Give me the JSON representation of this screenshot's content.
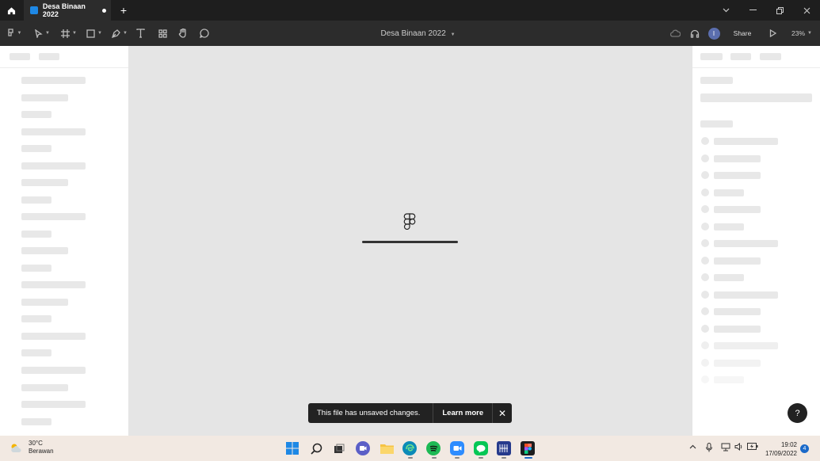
{
  "browser": {
    "tab_title": "Desa Binaan 2022",
    "new_tab": "+"
  },
  "toolbar": {
    "document_title": "Desa Binaan 2022",
    "avatar_initial": "I",
    "share_label": "Share",
    "zoom_level": "23%"
  },
  "canvas": {
    "loading_progress": 1.0
  },
  "toast": {
    "message": "This file has unsaved changes.",
    "learn_more": "Learn more",
    "close": "✕"
  },
  "help": {
    "label": "?"
  },
  "taskbar": {
    "temperature": "30°C",
    "weather": "Berawan",
    "time": "19:02",
    "date": "17/09/2022",
    "notification_count": "4",
    "apps": [
      "start",
      "search",
      "task-view",
      "teams",
      "file-explorer",
      "edge",
      "spotify",
      "zoom",
      "line",
      "photo-app",
      "figma"
    ]
  }
}
